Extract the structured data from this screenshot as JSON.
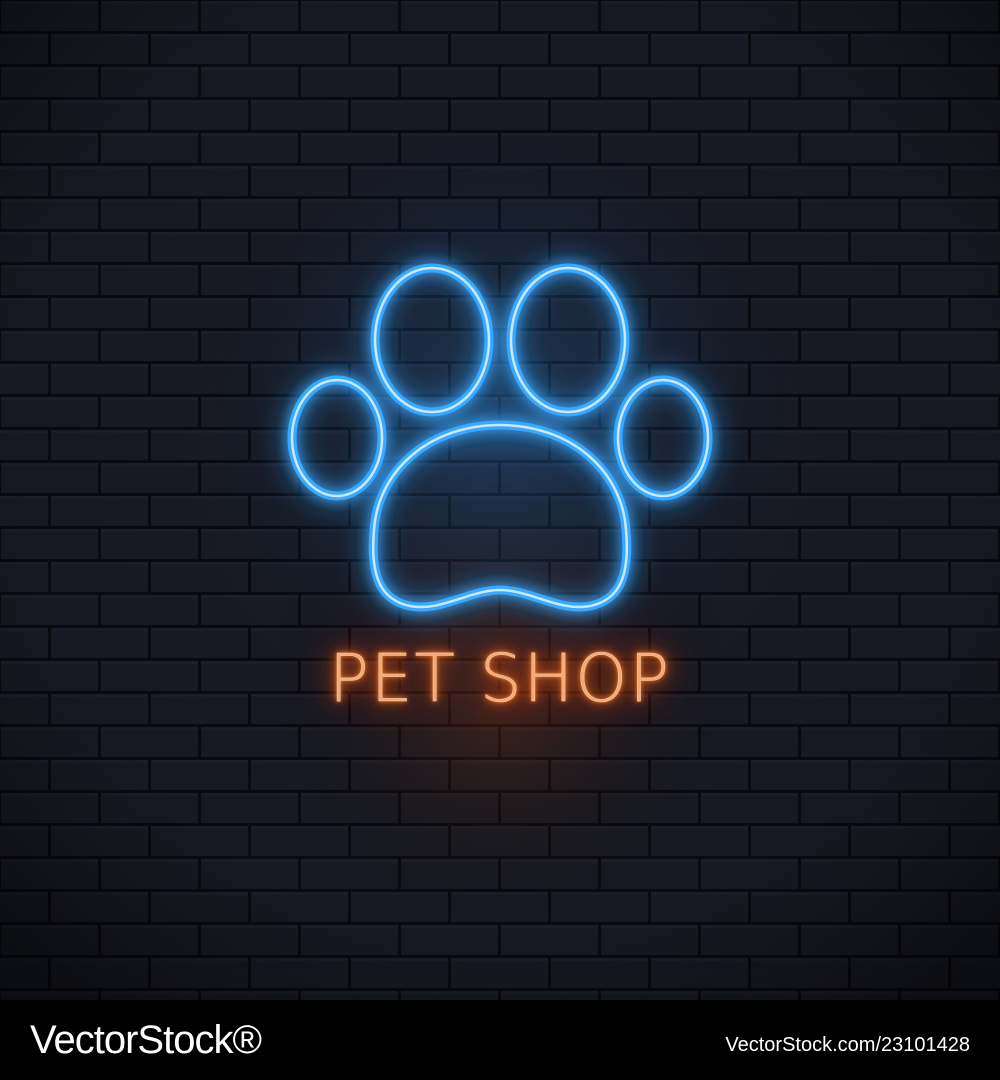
{
  "sign": {
    "text": "PET SHOP",
    "text_color": "#ff9a4a",
    "paw_color": "#4fb8ff"
  },
  "wall": {
    "brick_color": "#1c1f2a",
    "mortar_color": "#0b0c12"
  },
  "footer": {
    "brand": "VectorStock®",
    "stock_id": "VectorStock.com/23101428"
  },
  "icons": {
    "paw": "paw-print-icon"
  }
}
